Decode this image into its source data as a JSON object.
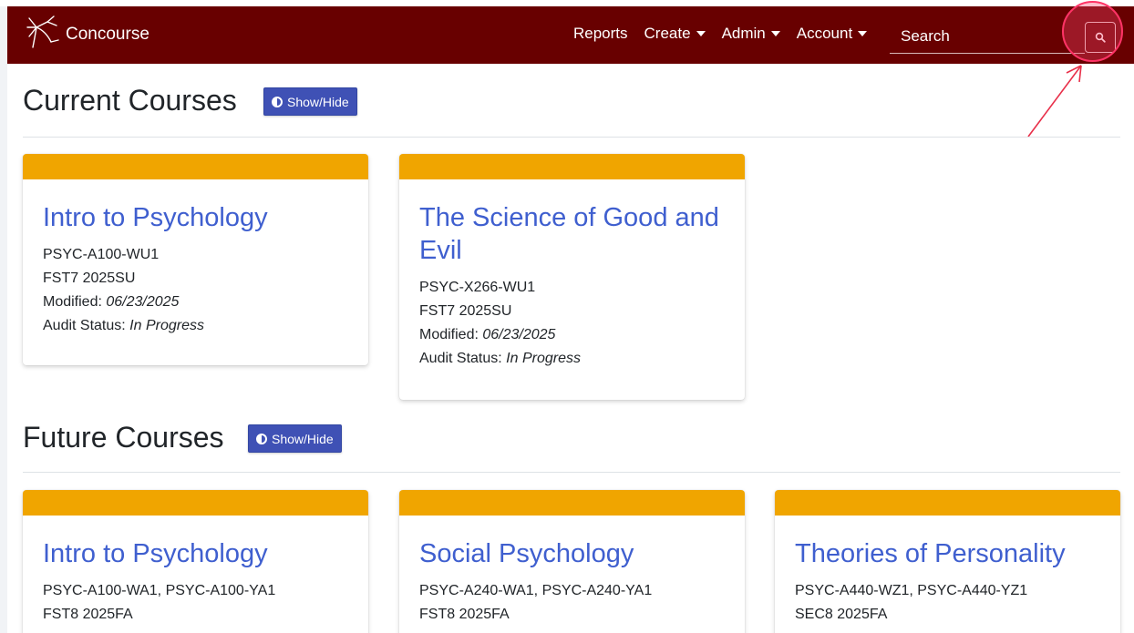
{
  "navbar": {
    "brand": "Concourse",
    "links": [
      {
        "label": "Reports",
        "dropdown": false
      },
      {
        "label": "Create",
        "dropdown": true
      },
      {
        "label": "Admin",
        "dropdown": true
      },
      {
        "label": "Account",
        "dropdown": true
      }
    ],
    "search_placeholder": "Search",
    "colors": {
      "bar": "#680000"
    }
  },
  "current": {
    "title": "Current Courses",
    "toggle_label": "Show/Hide",
    "courses": [
      {
        "title": "Intro to Psychology",
        "code": "PSYC-A100-WU1",
        "term": "FST7 2025SU",
        "modified_label": "Modified:",
        "modified": "06/23/2025",
        "audit_label": "Audit Status:",
        "audit": "In Progress"
      },
      {
        "title": "The Science of Good and Evil",
        "code": "PSYC-X266-WU1",
        "term": "FST7 2025SU",
        "modified_label": "Modified:",
        "modified": "06/23/2025",
        "audit_label": "Audit Status:",
        "audit": "In Progress"
      }
    ]
  },
  "future": {
    "title": "Future Courses",
    "toggle_label": "Show/Hide",
    "courses": [
      {
        "title": "Intro to Psychology",
        "code": "PSYC-A100-WA1, PSYC-A100-YA1",
        "term": "FST8 2025FA"
      },
      {
        "title": "Social Psychology",
        "code": "PSYC-A240-WA1, PSYC-A240-YA1",
        "term": "FST8 2025FA"
      },
      {
        "title": "Theories of Personality",
        "code": "PSYC-A440-WZ1, PSYC-A440-YZ1",
        "term": "SEC8 2025FA"
      }
    ]
  },
  "colors": {
    "card_header": "#f0a500",
    "card_title": "#3f5fcf",
    "button": "#3f51b5",
    "highlight": "#ff3366"
  }
}
